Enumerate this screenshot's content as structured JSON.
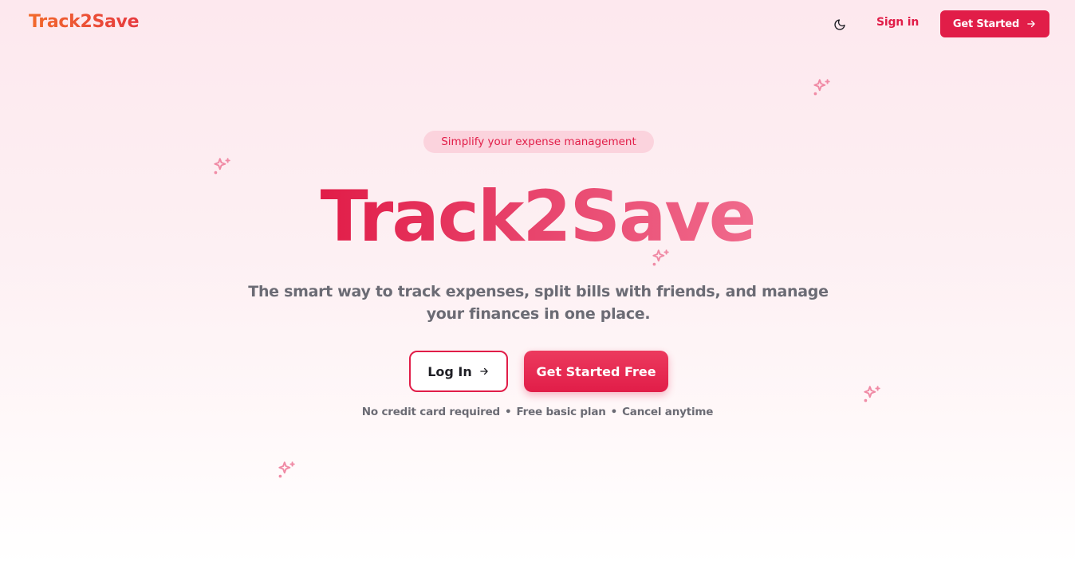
{
  "nav": {
    "logo": "Track2Save",
    "signin_label": "Sign in",
    "cta_label": "Get Started",
    "theme_icon": "moon-icon"
  },
  "hero": {
    "badge": "Simplify your expense management",
    "title": "Track2Save",
    "subtitle": "The smart way to track expenses, split bills with friends, and manage your finances in one place.",
    "login_label": "Log In",
    "start_label": "Get Started Free",
    "perks": [
      "No credit card required",
      "Free basic plan",
      "Cancel anytime"
    ],
    "perk_separator": "•"
  },
  "colors": {
    "brand": "#e11d48",
    "logo_start": "#f26a2b",
    "logo_end": "#e63a3f",
    "sparkle": "#f08aa5"
  }
}
